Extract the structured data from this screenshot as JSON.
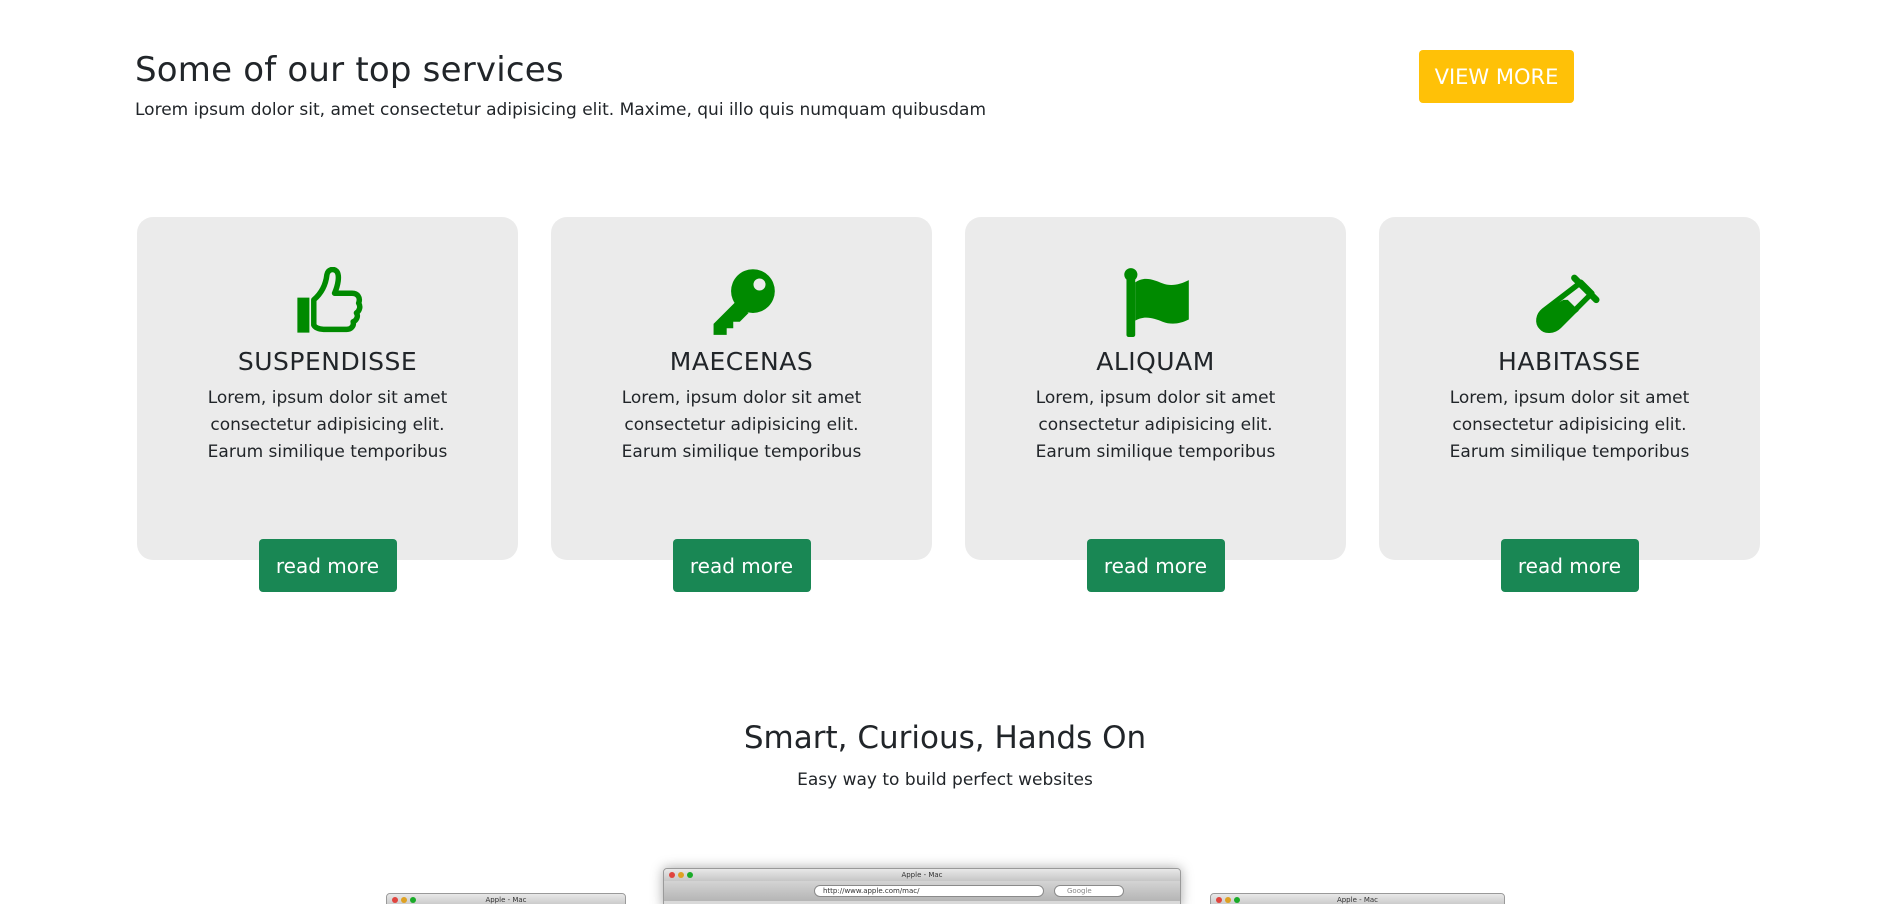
{
  "services": {
    "title": "Some of our top services",
    "subtitle": "Lorem ipsum dolor sit, amet consectetur adipisicing elit. Maxime, qui illo quis numquam quibusdam",
    "view_more_label": "VIEW MORE"
  },
  "cards": [
    {
      "icon": "thumbs-up-icon",
      "title": "SUSPENDISSE",
      "text": "Lorem, ipsum dolor sit amet consectetur adipisicing elit. Earum similique temporibus",
      "button": "read more"
    },
    {
      "icon": "key-icon",
      "title": "MAECENAS",
      "text": "Lorem, ipsum dolor sit amet consectetur adipisicing elit. Earum similique temporibus",
      "button": "read more"
    },
    {
      "icon": "flag-icon",
      "title": "ALIQUAM",
      "text": "Lorem, ipsum dolor sit amet consectetur adipisicing elit. Earum similique temporibus",
      "button": "read more"
    },
    {
      "icon": "test-tube-icon",
      "title": "HABITASSE",
      "text": "Lorem, ipsum dolor sit amet consectetur adipisicing elit. Earum similique temporibus",
      "button": "read more"
    }
  ],
  "smart": {
    "title": "Smart, Curious, Hands On",
    "subtitle": "Easy way to build perfect websites"
  },
  "showcase": {
    "browser_title": "Apple - Mac",
    "url": "http://www.apple.com/mac/",
    "search_placeholder": "Google"
  },
  "colors": {
    "accent_yellow": "#ffc107",
    "button_green": "#198754",
    "icon_green": "#008a00",
    "card_bg": "#ebebeb"
  }
}
